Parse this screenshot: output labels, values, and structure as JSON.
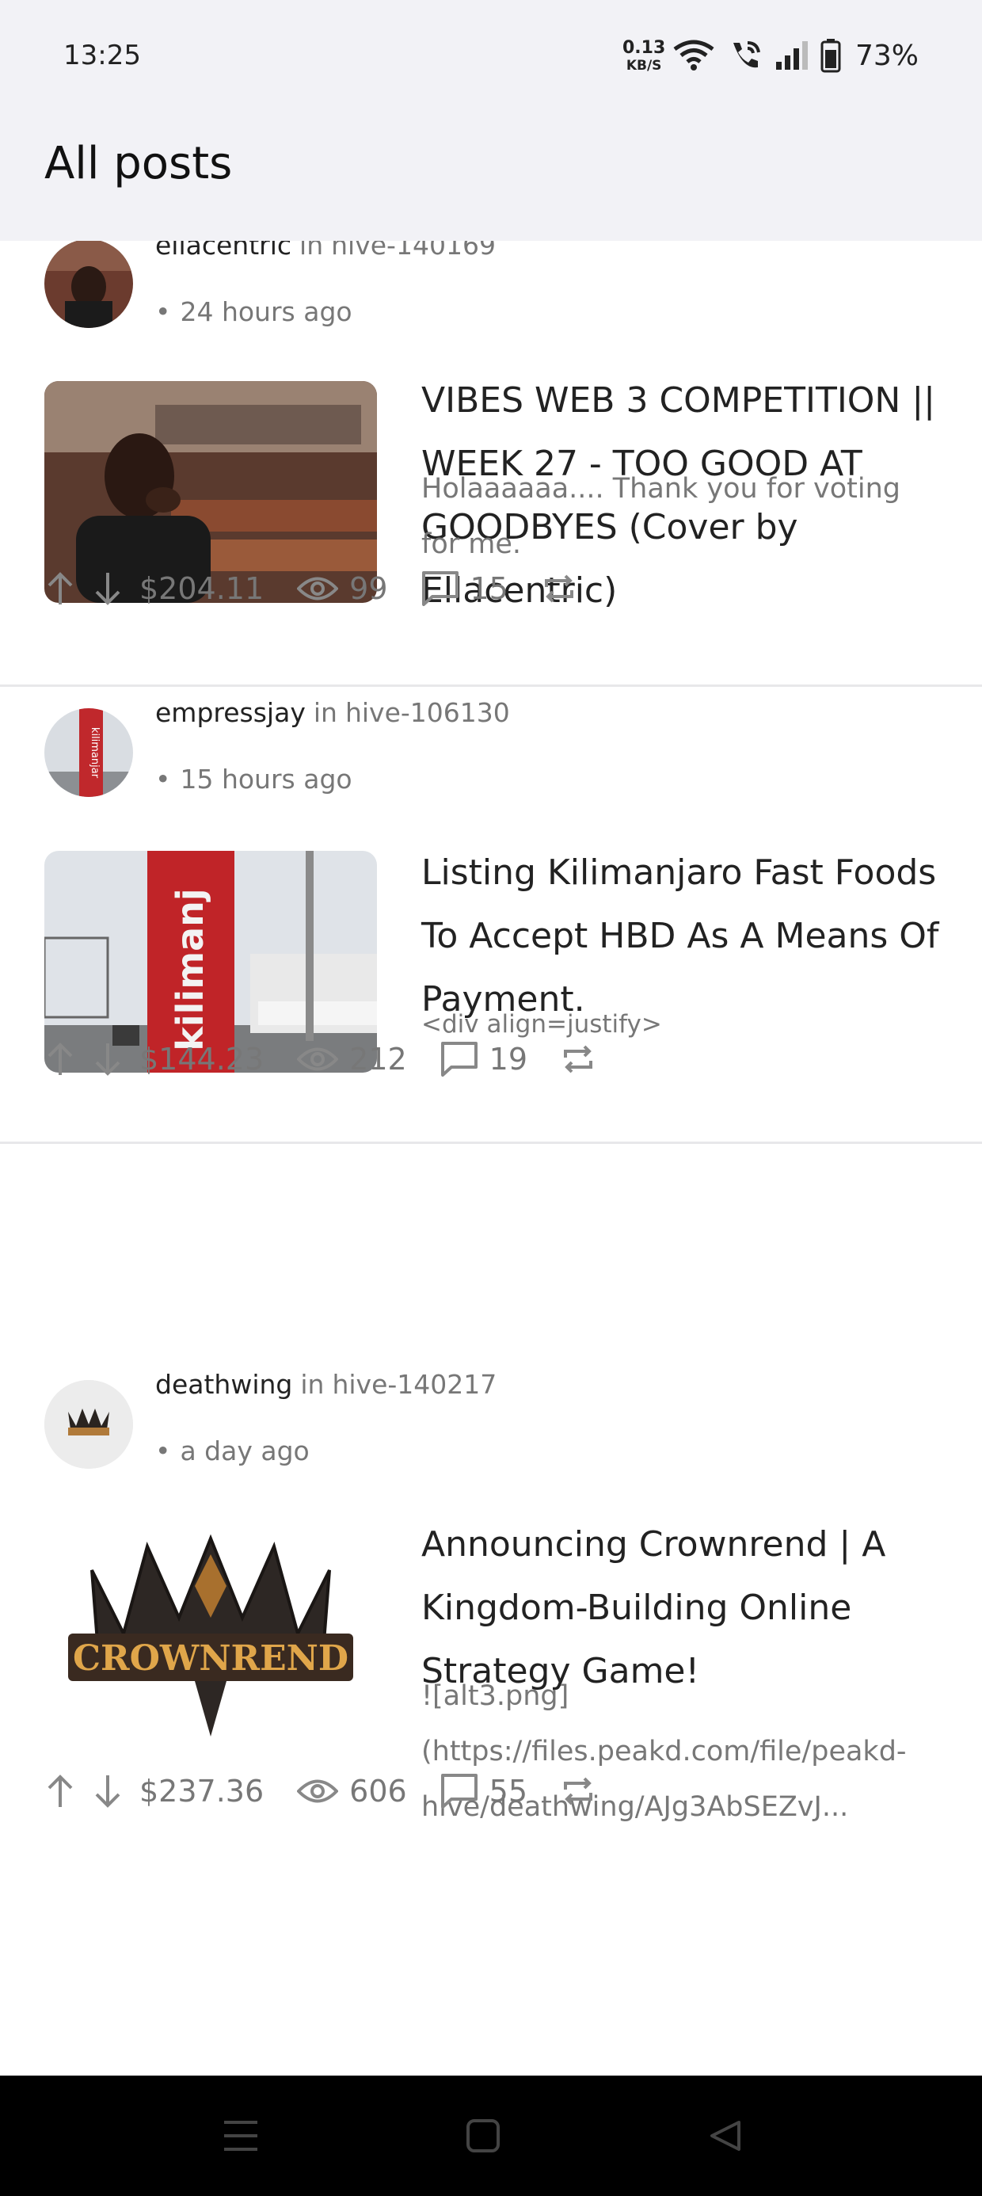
{
  "status_bar": {
    "time": "13:25",
    "net_speed_value": "0.13",
    "net_speed_unit": "KB/S",
    "battery": "73%"
  },
  "header": {
    "title": "All posts"
  },
  "posts": [
    {
      "author": "ellacentric",
      "in_label": "in",
      "community": "hive-140169",
      "time": "24 hours ago",
      "title": "VIBES WEB 3 COMPETITION || WEEK 27 - TOO GOOD AT GOODBYES (Cover by Ellacentric)",
      "excerpt": "Holaaaaaa.... Thank you for voting for me.",
      "payout": "$204.11",
      "views": "99",
      "comments": "15"
    },
    {
      "author": "empressjay",
      "in_label": "in",
      "community": "hive-106130",
      "time": "15 hours ago",
      "title": "Listing Kilimanjaro Fast Foods To Accept HBD As A Means Of Payment.",
      "excerpt": "<div align=justify>",
      "payout": "$144.23",
      "views": "212",
      "comments": "19",
      "thumb_sign_text": "kilimanj",
      "avatar_sign_text": "kilimanjar"
    },
    {
      "author": "deathwing",
      "in_label": "in",
      "community": "hive-140217",
      "time": "a day ago",
      "title": "Announcing Crownrend  | A Kingdom-Building Online Strategy Game!",
      "excerpt": "![alt3.png](https://files.peakd.com/file/peakd-hive/deathwing/AJg3AbSEZvJ...",
      "payout": "$237.36",
      "views": "606",
      "comments": "55",
      "logo_text": "CROWNREND"
    }
  ],
  "icons": {
    "upvote": "arrow-up-icon",
    "downvote": "arrow-down-icon",
    "views": "eye-icon",
    "comments": "comment-icon",
    "reblog": "repeat-icon"
  },
  "colors": {
    "app_bar_bg": "#f2f2f6",
    "text_primary": "#222222",
    "text_secondary": "#777777",
    "nav_bar_bg": "#000000"
  }
}
